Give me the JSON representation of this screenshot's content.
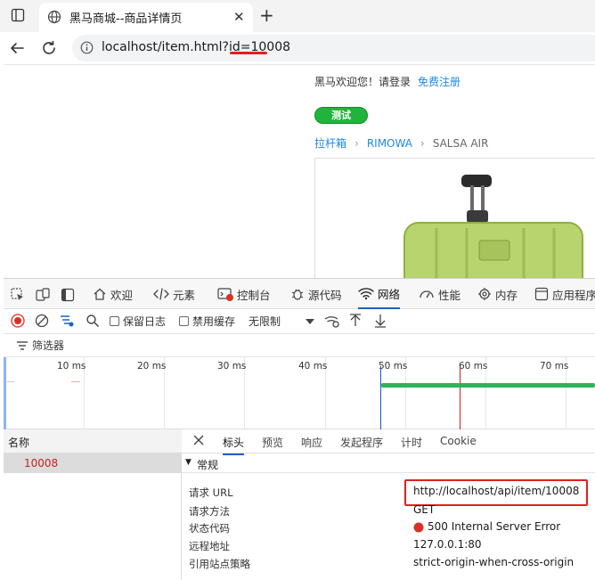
{
  "browser": {
    "tab_title": "黑马商城--商品详情页",
    "url": "localhost/item.html?id=10008",
    "new_tab_symbol": "+",
    "close_symbol": "✕"
  },
  "page": {
    "welcome": "黑马欢迎您！请登录",
    "register": "免费注册",
    "test_button": "测试",
    "breadcrumb": [
      "拉杆箱",
      "RIMOWA",
      "SALSA AIR"
    ]
  },
  "devtools": {
    "tabs": [
      "欢迎",
      "元素",
      "控制台",
      "源代码",
      "网络",
      "性能",
      "内存",
      "应用程序"
    ],
    "active_tab": "网络",
    "controls": {
      "preserve_log": "保留日志",
      "disable_cache": "禁用缓存",
      "throttle": "无限制"
    },
    "filter_label": "筛选器",
    "timeline_ticks": [
      "10 ms",
      "20 ms",
      "30 ms",
      "40 ms",
      "50 ms",
      "60 ms",
      "70 ms"
    ],
    "name_header": "名称",
    "request_name": "10008",
    "detail_tabs": [
      "标头",
      "预览",
      "响应",
      "发起程序",
      "计时",
      "Cookie"
    ],
    "section_title": "常规",
    "general": [
      {
        "key": "请求 URL",
        "value": "http://localhost/api/item/10008"
      },
      {
        "key": "请求方法",
        "value": "GET"
      },
      {
        "key": "状态代码",
        "value": "500 Internal Server Error"
      },
      {
        "key": "远程地址",
        "value": "127.0.0.1:80"
      },
      {
        "key": "引用站点策略",
        "value": "strict-origin-when-cross-origin"
      }
    ],
    "colors": {
      "accent": "#1565c0",
      "error": "#e02020",
      "success": "#1fb53c"
    }
  }
}
